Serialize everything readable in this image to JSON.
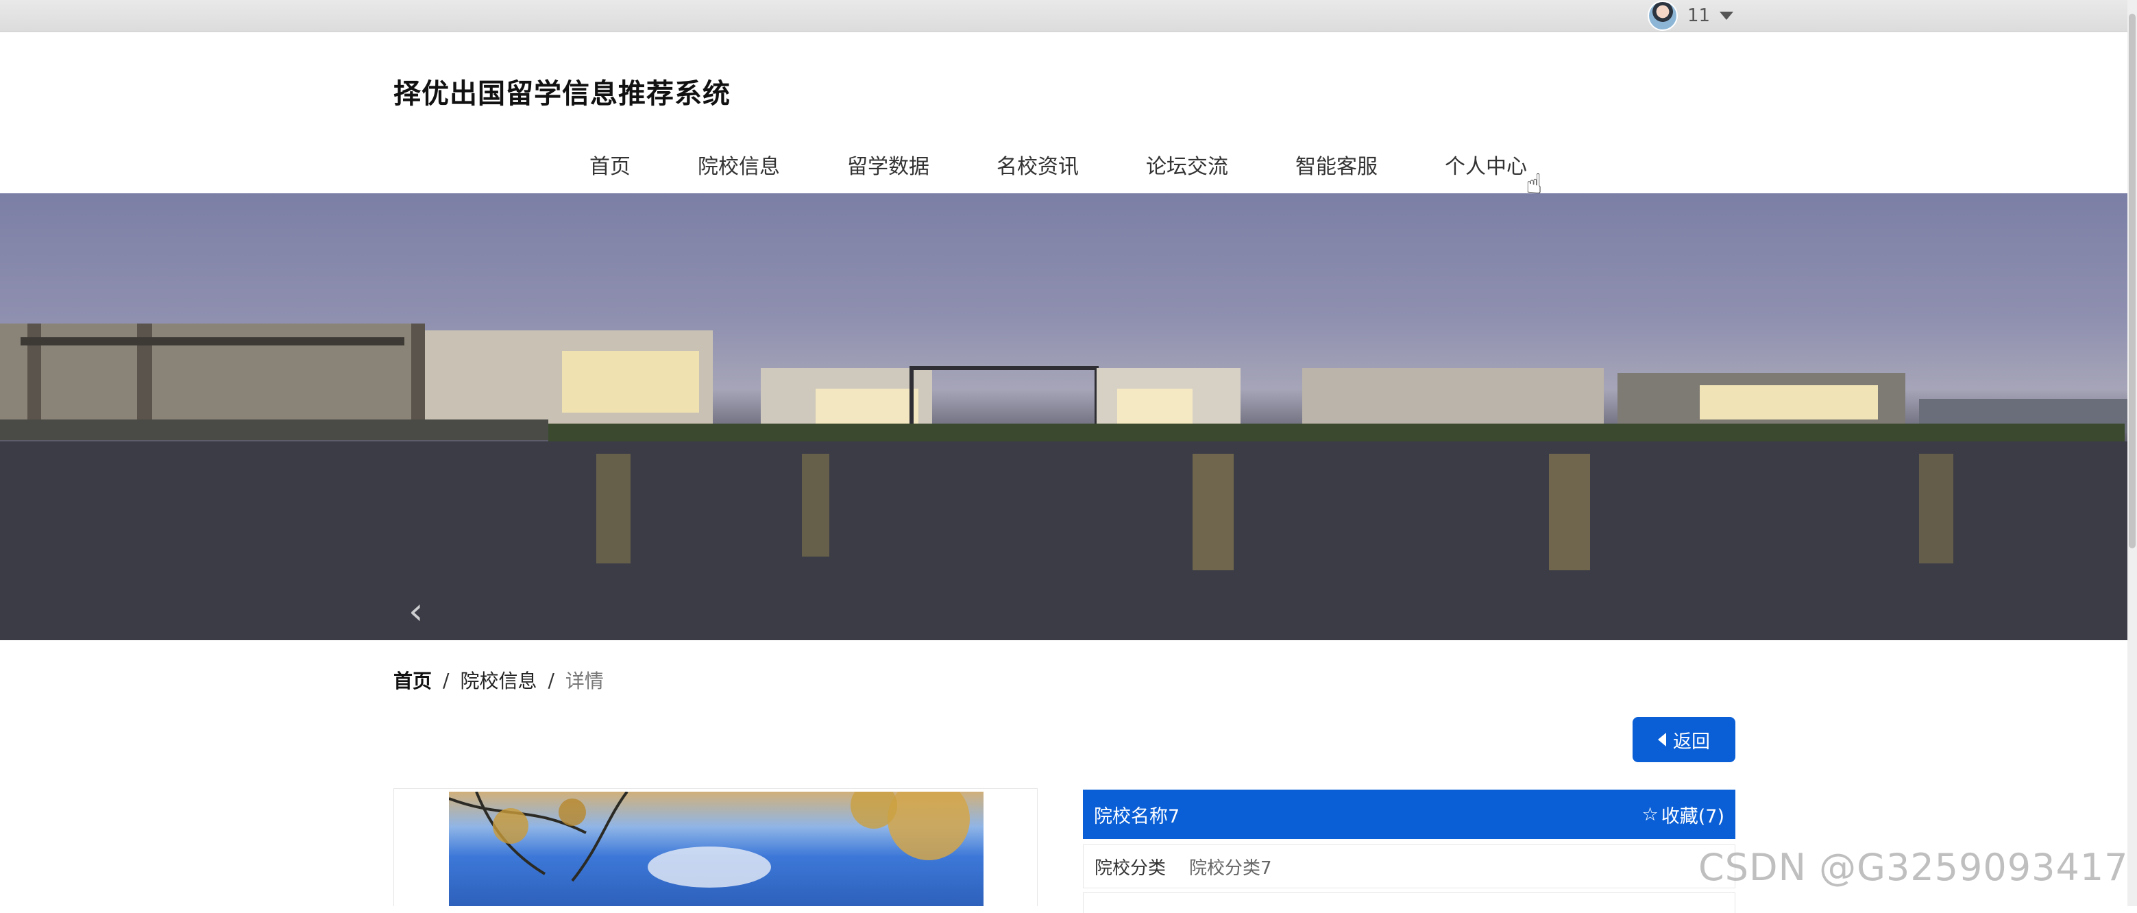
{
  "user": {
    "name": "11"
  },
  "site": {
    "title": "择优出国留学信息推荐系统"
  },
  "nav": {
    "items": [
      "首页",
      "院校信息",
      "留学数据",
      "名校资讯",
      "论坛交流",
      "智能客服",
      "个人中心"
    ]
  },
  "banner": {
    "active_slide": 3,
    "slide_count": 3
  },
  "breadcrumb": {
    "home": "首页",
    "section": "院校信息",
    "current": "详情",
    "separator": "/"
  },
  "actions": {
    "back_label": "返回"
  },
  "detail": {
    "name": "院校名称7",
    "favorite_label": "收藏(7)",
    "fields": [
      {
        "label": "院校分类",
        "value": "院校分类7"
      }
    ]
  },
  "watermark": {
    "text": "CSDN @G3259093417"
  },
  "icons": {
    "user_caret": "caret-down-icon",
    "star": "star-outline-icon",
    "back": "triangle-left-icon",
    "prev": "chevron-left-icon"
  },
  "colors": {
    "primary": "#0a5fd6",
    "topbar": "#e2e2e2"
  }
}
